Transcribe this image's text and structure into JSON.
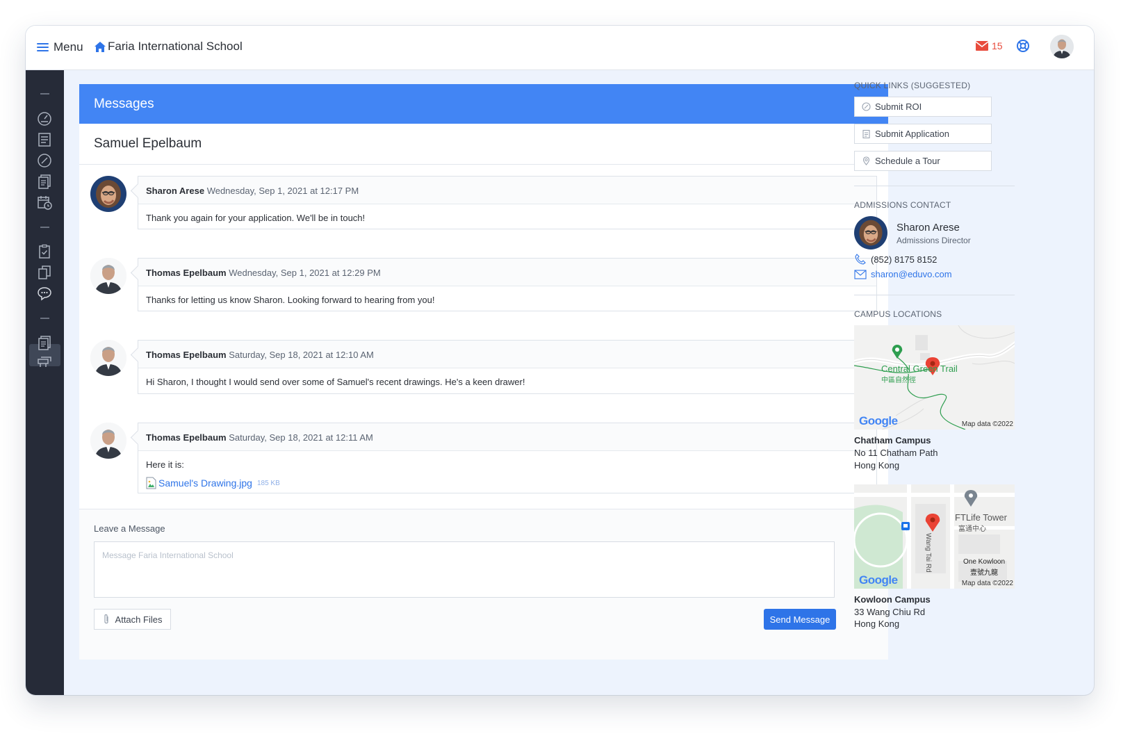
{
  "topbar": {
    "menu_label": "Menu",
    "school_name": "Faria International School",
    "mail_count": "15"
  },
  "sidebar": {
    "items": [
      "dashboard-icon",
      "forms-icon",
      "explore-icon",
      "documents-icon",
      "calendar-icon",
      "checklist-icon",
      "files-icon",
      "messages-icon",
      "reports-icon",
      "events-icon"
    ],
    "active": "messages-icon"
  },
  "messages": {
    "header": "Messages",
    "thread_title": "Samuel Epelbaum",
    "items": [
      {
        "author": "Sharon Arese",
        "date": "Wednesday, Sep 1, 2021 at 12:17 PM",
        "text": "Thank you again for your application. We'll be in touch!"
      },
      {
        "author": "Thomas Epelbaum",
        "date": "Wednesday, Sep 1, 2021 at 12:29 PM",
        "text": "Thanks for letting us know Sharon. Looking forward to hearing from you!"
      },
      {
        "author": "Thomas Epelbaum",
        "date": "Saturday, Sep 18, 2021 at 12:10 AM",
        "text": "Hi Sharon, I thought I would send over some of Samuel's recent drawings. He's a keen drawer!"
      },
      {
        "author": "Thomas Epelbaum",
        "date": "Saturday, Sep 18, 2021 at 12:11 AM",
        "text": "Here it is:",
        "attachment": {
          "name": "Samuel's Drawing.jpg",
          "size": "185 KB"
        }
      }
    ],
    "compose": {
      "label": "Leave a Message",
      "placeholder": "Message Faria International School",
      "attach_label": "Attach Files",
      "send_label": "Send Message"
    }
  },
  "quick_links": {
    "title": "QUICK LINKS (SUGGESTED)",
    "items": [
      {
        "label": "Submit ROI",
        "icon": "compass-icon"
      },
      {
        "label": "Submit Application",
        "icon": "clipboard-icon"
      },
      {
        "label": "Schedule a Tour",
        "icon": "location-icon"
      }
    ]
  },
  "admissions": {
    "title": "ADMISSIONS CONTACT",
    "name": "Sharon Arese",
    "role": "Admissions Director",
    "phone": "(852) 8175 8152",
    "email": "sharon@eduvo.com"
  },
  "campus": {
    "title": "CAMPUS LOCATIONS",
    "locations": [
      {
        "name": "Chatham Campus",
        "line1": "No 11 Chatham Path",
        "line2": "Hong Kong",
        "map": {
          "label": "Central Green Trail",
          "label_cn": "中區自然徑",
          "attribution": "Map data ©2022",
          "brand": "Google"
        }
      },
      {
        "name": "Kowloon Campus",
        "line1": "33 Wang Chiu Rd",
        "line2": "Hong Kong",
        "map": {
          "label": "FTLife Tower",
          "label_cn": "富通中心",
          "street": "Wang Tai Rd",
          "label2": "One Kowloon",
          "label2_cn": "壹號九龍",
          "attribution": "Map data ©2022",
          "brand": "Google"
        }
      }
    ]
  },
  "colors": {
    "accent": "#4285f4",
    "primary_button": "#2e74e8",
    "sidebar": "#262b38",
    "mail": "#e84c3d"
  }
}
